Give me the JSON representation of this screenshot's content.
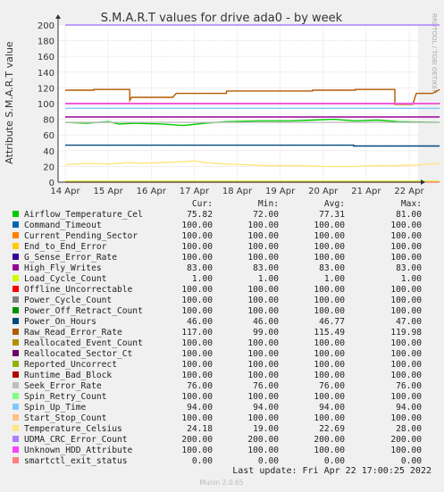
{
  "chart_data": {
    "type": "line",
    "title": "S.M.A.R.T values for drive ada0 - by week",
    "ylabel": "Attribute S.M.A.R.T value",
    "watermark": "RRDTOOL / TOBI OETIKER",
    "xlim": [
      "2022-04-14 00:00",
      "2022-04-22 17:00"
    ],
    "ylim": [
      0,
      200
    ],
    "y_ticks": [
      0,
      20,
      40,
      60,
      80,
      100,
      120,
      140,
      160,
      180,
      200
    ],
    "x_ticks": [
      {
        "date": "2022-04-14 00:00",
        "label": "14 Apr"
      },
      {
        "date": "2022-04-15 00:00",
        "label": "15 Apr"
      },
      {
        "date": "2022-04-16 00:00",
        "label": "16 Apr"
      },
      {
        "date": "2022-04-17 00:00",
        "label": "17 Apr"
      },
      {
        "date": "2022-04-18 00:00",
        "label": "18 Apr"
      },
      {
        "date": "2022-04-19 00:00",
        "label": "19 Apr"
      },
      {
        "date": "2022-04-20 00:00",
        "label": "20 Apr"
      },
      {
        "date": "2022-04-21 00:00",
        "label": "21 Apr"
      },
      {
        "date": "2022-04-22 00:00",
        "label": "22 Apr"
      }
    ],
    "grid": true,
    "legend_headers": [
      "Cur:",
      "Min:",
      "Avg:",
      "Max:"
    ],
    "series": [
      {
        "name": "Airflow_Temperature_Cel",
        "color": "#00cc00",
        "cur": "75.82",
        "min": "72.00",
        "avg": "77.31",
        "max": "81.00",
        "points": [
          [
            "2022-04-14 00:00",
            76
          ],
          [
            "2022-04-14 12:00",
            75
          ],
          [
            "2022-04-15 00:00",
            77
          ],
          [
            "2022-04-15 06:00",
            74
          ],
          [
            "2022-04-15 15:00",
            75
          ],
          [
            "2022-04-16 06:00",
            74
          ],
          [
            "2022-04-16 18:00",
            72
          ],
          [
            "2022-04-17 06:00",
            75
          ],
          [
            "2022-04-17 18:00",
            77
          ],
          [
            "2022-04-18 12:00",
            78
          ],
          [
            "2022-04-19 06:00",
            78
          ],
          [
            "2022-04-19 18:00",
            79
          ],
          [
            "2022-04-20 06:00",
            80
          ],
          [
            "2022-04-20 18:00",
            78
          ],
          [
            "2022-04-21 06:00",
            79
          ],
          [
            "2022-04-21 18:00",
            77
          ],
          [
            "2022-04-22 17:00",
            76
          ]
        ]
      },
      {
        "name": "Command_Timeout",
        "color": "#0066b3",
        "cur": "100.00",
        "min": "100.00",
        "avg": "100.00",
        "max": "100.00",
        "points": [
          [
            "2022-04-14 00:00",
            100
          ],
          [
            "2022-04-22 17:00",
            100
          ]
        ]
      },
      {
        "name": "Current_Pending_Sector",
        "color": "#ff8000",
        "cur": "100.00",
        "min": "100.00",
        "avg": "100.00",
        "max": "100.00",
        "points": [
          [
            "2022-04-14 00:00",
            100
          ],
          [
            "2022-04-22 17:00",
            100
          ]
        ]
      },
      {
        "name": "End_to_End_Error",
        "color": "#ffcc00",
        "cur": "100.00",
        "min": "100.00",
        "avg": "100.00",
        "max": "100.00",
        "points": [
          [
            "2022-04-14 00:00",
            100
          ],
          [
            "2022-04-22 17:00",
            100
          ]
        ]
      },
      {
        "name": "G_Sense_Error_Rate",
        "color": "#330099",
        "cur": "100.00",
        "min": "100.00",
        "avg": "100.00",
        "max": "100.00",
        "points": [
          [
            "2022-04-14 00:00",
            100
          ],
          [
            "2022-04-22 17:00",
            100
          ]
        ]
      },
      {
        "name": "High_Fly_Writes",
        "color": "#990099",
        "cur": "83.00",
        "min": "83.00",
        "avg": "83.00",
        "max": "83.00",
        "points": [
          [
            "2022-04-14 00:00",
            83
          ],
          [
            "2022-04-22 17:00",
            83
          ]
        ]
      },
      {
        "name": "Load_Cycle_Count",
        "color": "#ccff00",
        "cur": "1.00",
        "min": "1.00",
        "avg": "1.00",
        "max": "1.00",
        "points": [
          [
            "2022-04-14 00:00",
            1
          ],
          [
            "2022-04-22 17:00",
            1
          ]
        ]
      },
      {
        "name": "Offline_Uncorrectable",
        "color": "#ff0000",
        "cur": "100.00",
        "min": "100.00",
        "avg": "100.00",
        "max": "100.00",
        "points": [
          [
            "2022-04-14 00:00",
            100
          ],
          [
            "2022-04-22 17:00",
            100
          ]
        ]
      },
      {
        "name": "Power_Cycle_Count",
        "color": "#808080",
        "cur": "100.00",
        "min": "100.00",
        "avg": "100.00",
        "max": "100.00",
        "points": [
          [
            "2022-04-14 00:00",
            100
          ],
          [
            "2022-04-22 17:00",
            100
          ]
        ]
      },
      {
        "name": "Power_Off_Retract_Count",
        "color": "#008f00",
        "cur": "100.00",
        "min": "100.00",
        "avg": "100.00",
        "max": "100.00",
        "points": [
          [
            "2022-04-14 00:00",
            100
          ],
          [
            "2022-04-22 17:00",
            100
          ]
        ]
      },
      {
        "name": "Power_On_Hours",
        "color": "#00487d",
        "cur": "46.00",
        "min": "46.00",
        "avg": "46.77",
        "max": "47.00",
        "points": [
          [
            "2022-04-14 00:00",
            47
          ],
          [
            "2022-04-20 17:00",
            47
          ],
          [
            "2022-04-20 17:00",
            46
          ],
          [
            "2022-04-22 17:00",
            46
          ]
        ]
      },
      {
        "name": "Raw_Read_Error_Rate",
        "color": "#b35a00",
        "cur": "117.00",
        "min": "99.00",
        "avg": "115.49",
        "max": "119.98",
        "points": [
          [
            "2022-04-14 00:00",
            117
          ],
          [
            "2022-04-14 16:00",
            117
          ],
          [
            "2022-04-14 16:00",
            118
          ],
          [
            "2022-04-15 12:00",
            118
          ],
          [
            "2022-04-15 12:00",
            104
          ],
          [
            "2022-04-15 13:00",
            108
          ],
          [
            "2022-04-16 12:00",
            108
          ],
          [
            "2022-04-16 14:00",
            113
          ],
          [
            "2022-04-17 18:00",
            113
          ],
          [
            "2022-04-17 18:00",
            116
          ],
          [
            "2022-04-19 18:00",
            116
          ],
          [
            "2022-04-19 18:00",
            117
          ],
          [
            "2022-04-20 18:00",
            117
          ],
          [
            "2022-04-20 18:00",
            118
          ],
          [
            "2022-04-21 16:00",
            118
          ],
          [
            "2022-04-21 16:00",
            99
          ],
          [
            "2022-04-22 02:00",
            99
          ],
          [
            "2022-04-22 04:00",
            113
          ],
          [
            "2022-04-22 13:00",
            113
          ],
          [
            "2022-04-22 17:00",
            118
          ]
        ]
      },
      {
        "name": "Reallocated_Event_Count",
        "color": "#b38f00",
        "cur": "100.00",
        "min": "100.00",
        "avg": "100.00",
        "max": "100.00",
        "points": [
          [
            "2022-04-14 00:00",
            100
          ],
          [
            "2022-04-22 17:00",
            100
          ]
        ]
      },
      {
        "name": "Reallocated_Sector_Ct",
        "color": "#6b006b",
        "cur": "100.00",
        "min": "100.00",
        "avg": "100.00",
        "max": "100.00",
        "points": [
          [
            "2022-04-14 00:00",
            100
          ],
          [
            "2022-04-22 17:00",
            100
          ]
        ]
      },
      {
        "name": "Reported_Uncorrect",
        "color": "#8fb300",
        "cur": "100.00",
        "min": "100.00",
        "avg": "100.00",
        "max": "100.00",
        "points": [
          [
            "2022-04-14 00:00",
            100
          ],
          [
            "2022-04-22 17:00",
            100
          ]
        ]
      },
      {
        "name": "Runtime_Bad_Block",
        "color": "#b30000",
        "cur": "100.00",
        "min": "100.00",
        "avg": "100.00",
        "max": "100.00",
        "points": [
          [
            "2022-04-14 00:00",
            100
          ],
          [
            "2022-04-22 17:00",
            100
          ]
        ]
      },
      {
        "name": "Seek_Error_Rate",
        "color": "#bebebe",
        "cur": "76.00",
        "min": "76.00",
        "avg": "76.00",
        "max": "76.00",
        "points": [
          [
            "2022-04-14 00:00",
            76
          ],
          [
            "2022-04-22 17:00",
            76
          ]
        ]
      },
      {
        "name": "Spin_Retry_Count",
        "color": "#80ff80",
        "cur": "100.00",
        "min": "100.00",
        "avg": "100.00",
        "max": "100.00",
        "points": [
          [
            "2022-04-14 00:00",
            100
          ],
          [
            "2022-04-22 17:00",
            100
          ]
        ]
      },
      {
        "name": "Spin_Up_Time",
        "color": "#80c9ff",
        "cur": "94.00",
        "min": "94.00",
        "avg": "94.00",
        "max": "94.00",
        "points": [
          [
            "2022-04-14 00:00",
            94
          ],
          [
            "2022-04-22 17:00",
            94
          ]
        ]
      },
      {
        "name": "Start_Stop_Count",
        "color": "#ffc080",
        "cur": "100.00",
        "min": "100.00",
        "avg": "100.00",
        "max": "100.00",
        "points": [
          [
            "2022-04-14 00:00",
            100
          ],
          [
            "2022-04-22 17:00",
            100
          ]
        ]
      },
      {
        "name": "Temperature_Celsius",
        "color": "#ffe680",
        "cur": "24.18",
        "min": "19.00",
        "avg": "22.69",
        "max": "28.00",
        "points": [
          [
            "2022-04-14 00:00",
            22
          ],
          [
            "2022-04-14 06:00",
            23
          ],
          [
            "2022-04-14 12:00",
            24
          ],
          [
            "2022-04-15 00:00",
            23
          ],
          [
            "2022-04-15 12:00",
            25
          ],
          [
            "2022-04-15 18:00",
            24
          ],
          [
            "2022-04-16 06:00",
            25
          ],
          [
            "2022-04-16 18:00",
            26
          ],
          [
            "2022-04-17 00:00",
            27
          ],
          [
            "2022-04-17 06:00",
            25
          ],
          [
            "2022-04-17 18:00",
            23
          ],
          [
            "2022-04-18 06:00",
            22
          ],
          [
            "2022-04-18 18:00",
            21
          ],
          [
            "2022-04-19 12:00",
            21
          ],
          [
            "2022-04-20 00:00",
            20
          ],
          [
            "2022-04-20 18:00",
            20
          ],
          [
            "2022-04-21 06:00",
            21
          ],
          [
            "2022-04-21 18:00",
            21
          ],
          [
            "2022-04-22 06:00",
            22
          ],
          [
            "2022-04-22 17:00",
            24
          ]
        ]
      },
      {
        "name": "UDMA_CRC_Error_Count",
        "color": "#aa80ff",
        "cur": "200.00",
        "min": "200.00",
        "avg": "200.00",
        "max": "200.00",
        "points": [
          [
            "2022-04-14 00:00",
            200
          ],
          [
            "2022-04-22 17:00",
            200
          ]
        ]
      },
      {
        "name": "Unknown_HDD_Attribute",
        "color": "#ff40ff",
        "cur": "100.00",
        "min": "100.00",
        "avg": "100.00",
        "max": "100.00",
        "points": [
          [
            "2022-04-14 00:00",
            100
          ],
          [
            "2022-04-22 17:00",
            100
          ]
        ]
      },
      {
        "name": "smartctl_exit_status",
        "color": "#ff8080",
        "cur": "0.00",
        "min": "0.00",
        "avg": "0.00",
        "max": "0.00",
        "points": [
          [
            "2022-04-14 00:00",
            0
          ],
          [
            "2022-04-22 17:00",
            0
          ]
        ]
      }
    ]
  },
  "footer": {
    "last_update": "Last update: Fri Apr 22 17:00:25 2022",
    "munin": "Munin 2.0.65"
  }
}
